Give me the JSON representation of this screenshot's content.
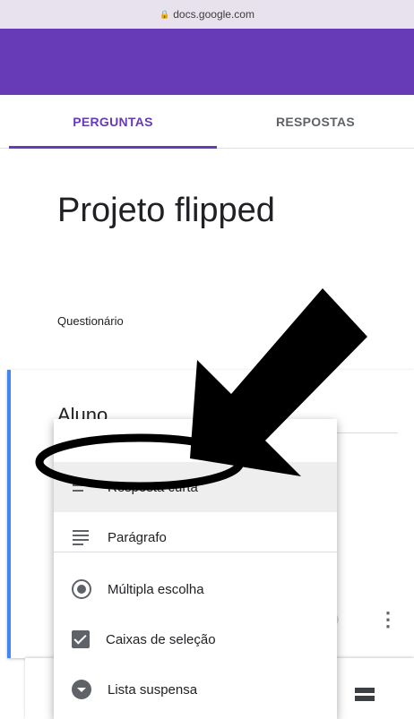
{
  "browser": {
    "url": "docs.google.com",
    "lock_icon": "lock-icon"
  },
  "tabs": [
    {
      "label": "PERGUNTAS",
      "active": true
    },
    {
      "label": "RESPOSTAS",
      "active": false
    }
  ],
  "form": {
    "title": "Projeto flipped",
    "description": "Questionário"
  },
  "question": {
    "title": "Aluno"
  },
  "type_menu": {
    "items": [
      {
        "label": "Resposta curta",
        "icon": "short-answer-icon",
        "selected": true
      },
      {
        "label": "Parágrafo",
        "icon": "paragraph-icon",
        "selected": false
      },
      {
        "label": "Múltipla escolha",
        "icon": "radio-button-icon",
        "selected": false
      },
      {
        "label": "Caixas de seleção",
        "icon": "checkbox-icon",
        "selected": false
      },
      {
        "label": "Lista suspensa",
        "icon": "dropdown-icon",
        "selected": false
      }
    ]
  },
  "colors": {
    "brand": "#673ab7",
    "accent": "#4285f4",
    "annotation": "#000000"
  }
}
